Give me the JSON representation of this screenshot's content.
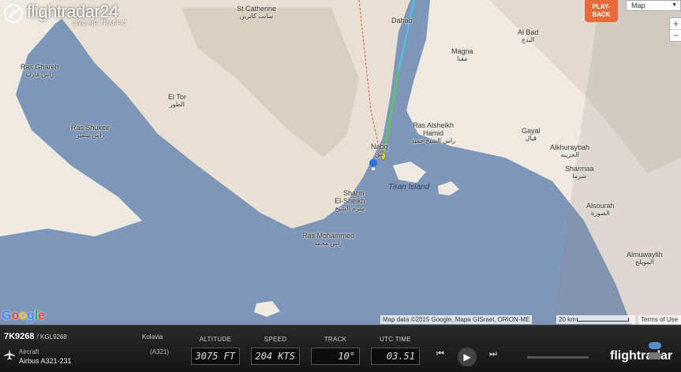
{
  "app": {
    "brand": "flightradar24",
    "tagline": "LIVE AIR TRAFFIC",
    "playback_label": "PLAY-\nBACK",
    "map_type": "Map",
    "zoom_in": "+",
    "zoom_out": "−"
  },
  "map": {
    "attribution": "Map data ©2015 Google, Mapa GISrael, ORION-ME",
    "scale_label": "20 km",
    "terms": "Terms of Use",
    "google_logo": "Google",
    "places": [
      {
        "id": "st-catherine",
        "name": "St Catherine",
        "ar": "سانت كاترين"
      },
      {
        "id": "dahab",
        "name": "Dahab",
        "ar": ""
      },
      {
        "id": "al-bad",
        "name": "Al Bad",
        "ar": "البدع"
      },
      {
        "id": "magna",
        "name": "Magna",
        "ar": "مقنا"
      },
      {
        "id": "ras-ghareb",
        "name": "Ras Ghareb",
        "ar": "راس غارب"
      },
      {
        "id": "el-tor",
        "name": "El Tor",
        "ar": "الطور"
      },
      {
        "id": "ras-shukeir",
        "name": "Ras Shukeir",
        "ar": "راس شقير"
      },
      {
        "id": "ras-alsheikh",
        "name": "Ras Alsheikh Hamid",
        "ar": "راس الشيخ حميد"
      },
      {
        "id": "gayal",
        "name": "Gayal",
        "ar": "قيال"
      },
      {
        "id": "alkhuraybah",
        "name": "Alkhuraybah",
        "ar": "الخريبة"
      },
      {
        "id": "sharmaa",
        "name": "Sharmaa",
        "ar": "شرما"
      },
      {
        "id": "alsourah",
        "name": "Alsourah",
        "ar": "الصورة"
      },
      {
        "id": "nabq",
        "name": "Nabq",
        "ar": "نبق"
      },
      {
        "id": "sharm",
        "name": "Sharm\nEl-Sheikh",
        "ar": "شرم الشيخ"
      },
      {
        "id": "almuwaylih",
        "name": "Almuwaylih",
        "ar": "المويلح"
      },
      {
        "id": "ras-mohammed",
        "name": "Ras Mohammed",
        "ar": "راس محمد"
      }
    ],
    "water": [
      {
        "id": "tiran",
        "name": "Tiran Island"
      }
    ]
  },
  "flight": {
    "callsign": "7K9268",
    "icao_callsign": "/ KGL9268",
    "airline": "Kolavia",
    "aircraft_label": "Aircraft",
    "aircraft_code": "(A321)",
    "aircraft_model": "Airbus A321-231"
  },
  "readouts": {
    "altitude_label": "ALTITUDE",
    "altitude": "3075 FT",
    "speed_label": "SPEED",
    "speed": "204 KTS",
    "track_label": "TRACK",
    "track": "10°",
    "utc_label": "UTC TIME",
    "utc": "03.51"
  },
  "controls": {
    "rewind": "⏮",
    "play": "▶",
    "forward": "⏭",
    "brand_small": "flightradar"
  },
  "colors": {
    "water": "#7e97b8",
    "land": "#eeeae1",
    "track_cyan": "#3ec9e6",
    "track_green": "#55d24a",
    "route_red": "#e35050",
    "playback": "#e86a3a"
  }
}
